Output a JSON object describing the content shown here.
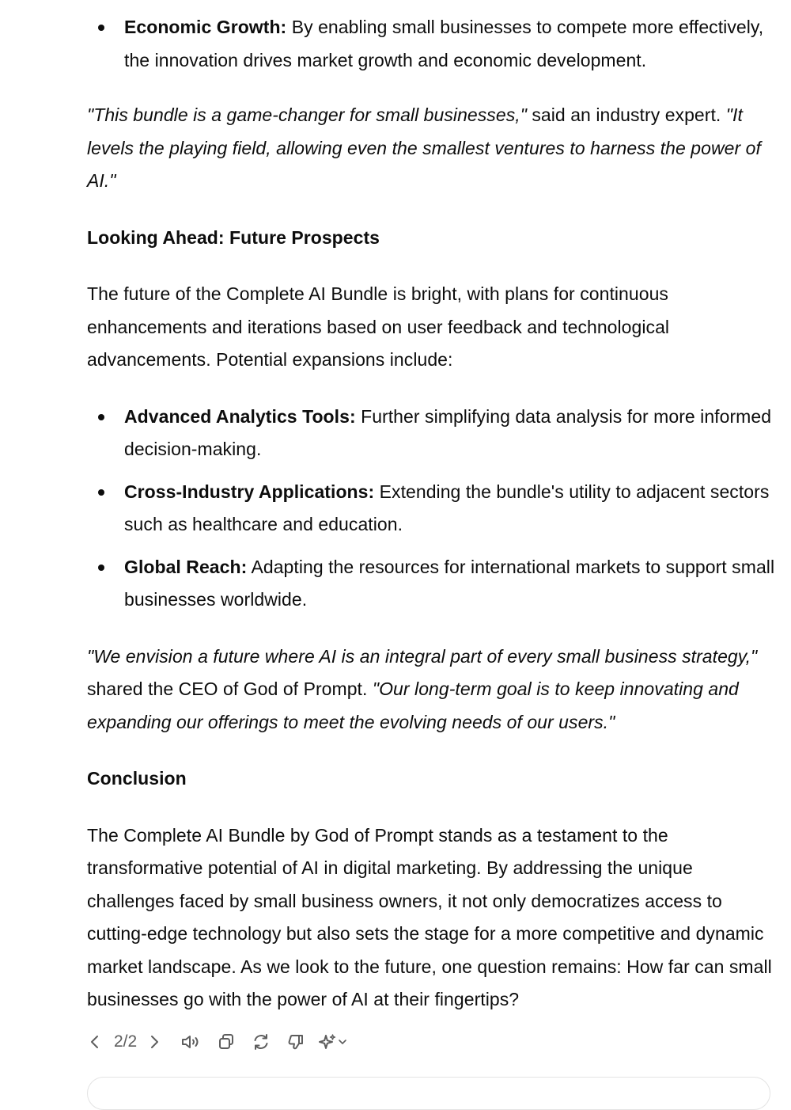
{
  "article": {
    "bullet_econ": {
      "label": "Economic Growth:",
      "text": " By enabling small businesses to compete more effectively, the innovation drives market growth and economic development."
    },
    "quote1": {
      "italic_a": "\"This bundle is a game-changer for small businesses,\"",
      "plain": " said an industry expert. ",
      "italic_b": "\"It levels the playing field, allowing even the smallest ventures to harness the power of AI.\""
    },
    "heading_future": "Looking Ahead: Future Prospects",
    "future_paragraph": "The future of the Complete AI Bundle is bright, with plans for continuous enhancements and iterations based on user feedback and technological advancements. Potential expansions include:",
    "prospects": [
      {
        "label": "Advanced Analytics Tools:",
        "text": " Further simplifying data analysis for more informed decision-making."
      },
      {
        "label": "Cross-Industry Applications:",
        "text": " Extending the bundle's utility to adjacent sectors such as healthcare and education."
      },
      {
        "label": "Global Reach:",
        "text": " Adapting the resources for international markets to support small businesses worldwide."
      }
    ],
    "quote2": {
      "italic_a": "\"We envision a future where AI is an integral part of every small business strategy,\"",
      "plain": " shared the CEO of God of Prompt. ",
      "italic_b": "\"Our long-term goal is to keep innovating and expanding our offerings to meet the evolving needs of our users.\""
    },
    "heading_conclusion": "Conclusion",
    "conclusion_paragraph": "The Complete AI Bundle by God of Prompt stands as a testament to the transformative potential of AI in digital marketing. By addressing the unique challenges faced by small business owners, it not only democratizes access to cutting-edge technology but also sets the stage for a more competitive and dynamic market landscape. As we look to the future, one question remains: How far can small businesses go with the power of AI at their fingertips?"
  },
  "actions": {
    "pager": "2/2",
    "icons": {
      "prev": "chevron-left-icon",
      "next": "chevron-right-icon",
      "read_aloud": "speaker-icon",
      "copy": "copy-icon",
      "regenerate": "refresh-icon",
      "dislike": "thumbs-down-icon",
      "model": "sparkle-icon",
      "model_menu": "chevron-down-icon"
    },
    "icon_color": "#5d5d5d"
  }
}
